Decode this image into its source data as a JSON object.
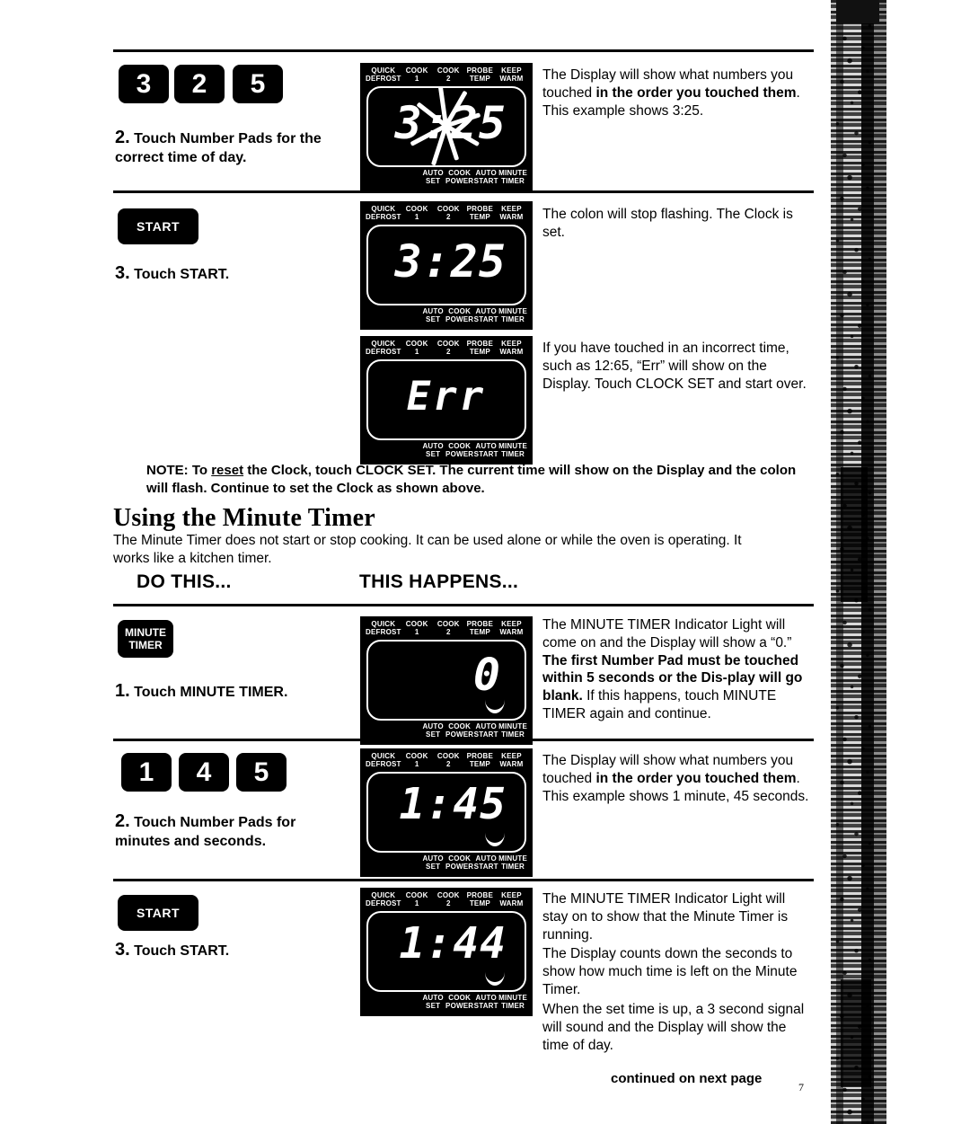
{
  "page": {
    "number": "7",
    "continued": "continued on next page"
  },
  "panel_labels": {
    "top": [
      "QUICK\nDEFROST",
      "COOK\n1",
      "COOK\n2",
      "PROBE\nTEMP",
      "KEEP\nWARM"
    ],
    "top_flat": [
      {
        "l1": "QUICK",
        "l2": "DEFROST"
      },
      {
        "l1": "COOK",
        "l2": "1"
      },
      {
        "l1": "COOK",
        "l2": "2"
      },
      {
        "l1": "PROBE",
        "l2": "TEMP"
      },
      {
        "l1": "KEEP",
        "l2": "WARM"
      }
    ],
    "bottom_flat": [
      {
        "l1": "AUTO",
        "l2": "SET"
      },
      {
        "l1": "COOK",
        "l2": "POWER"
      },
      {
        "l1": "AUTO",
        "l2": "START"
      },
      {
        "l1": "MINUTE",
        "l2": "TIMER"
      }
    ]
  },
  "clock_section": {
    "step2": {
      "pads": [
        "3",
        "2",
        "5"
      ],
      "number": "2.",
      "text": "Touch Number Pads for the correct time of day.",
      "display_value": "3:25",
      "display_flashing": true,
      "result_html": "The Display will show what numbers you touched <b>in the order you touched them</b>. This example shows 3:25."
    },
    "step3": {
      "pad_label": "START",
      "number": "3.",
      "text": "Touch START.",
      "display_value": "3:25",
      "result_html": "The colon will stop flashing. The Clock is set."
    },
    "error": {
      "display_value": "Err",
      "result_html": "If you have touched in an incorrect time, such as 12:65, “Err” will show on the Display. Touch CLOCK SET and start over."
    },
    "note_html": "NOTE: To <u>reset</u> the Clock, touch CLOCK SET. The current time will show on the Display and the colon will flash. Continue to set the Clock as shown above."
  },
  "minute_timer_section": {
    "heading": "Using the Minute Timer",
    "intro": "The Minute Timer does not start or stop cooking. It can be used alone or while the oven is operating. It works like a kitchen timer.",
    "col_left": "DO THIS...",
    "col_right": "THIS HAPPENS...",
    "step1": {
      "pad_l1": "MINUTE",
      "pad_l2": "TIMER",
      "number": "1.",
      "text": "Touch MINUTE TIMER.",
      "display_value": "0",
      "indicator_on": true,
      "result_html": "The MINUTE TIMER Indicator Light will come on and the Display will show a “0.” <b>The first Number Pad must be touched within 5 seconds or the Dis&#8209;play will go blank.</b> If this happens, touch MINUTE TIMER again and continue."
    },
    "step2": {
      "pads": [
        "1",
        "4",
        "5"
      ],
      "number": "2.",
      "text": "Touch Number Pads for minutes and seconds.",
      "display_value": "1:45",
      "indicator_on": true,
      "result_html": "The Display will show what numbers you touched <b>in the order you touched them</b>. This example shows 1 minute, 45 seconds."
    },
    "step3": {
      "pad_label": "START",
      "number": "3.",
      "text": "Touch START.",
      "display_value": "1:44",
      "indicator_on": true,
      "result_p1": "The MINUTE TIMER Indicator Light will stay on to show that the Minute Timer is running.",
      "result_p2": "The Display counts down the seconds to show how much time is left on the Minute Timer.",
      "result_p3": "When the set time is up, a 3 second signal will sound and the Display will show the time of day."
    }
  },
  "colors": {
    "ink": "#000000",
    "paper": "#ffffff",
    "display_bg": "#000000",
    "segment": "#ffffff"
  }
}
